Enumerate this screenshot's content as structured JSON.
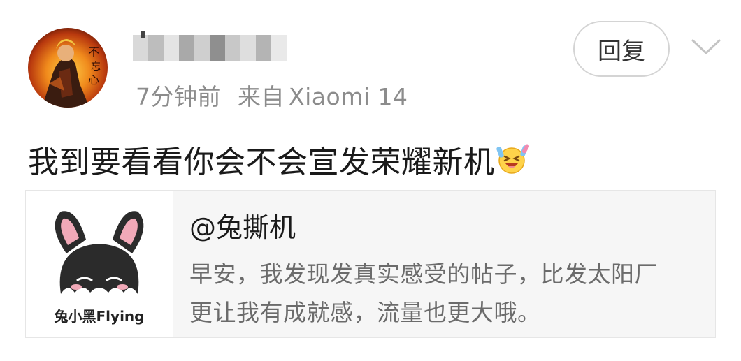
{
  "post": {
    "author_name": "",
    "time": "7分钟前",
    "source_label": "来自",
    "device": "Xiaomi 14",
    "reply_label": "回复",
    "text": "我到要看看你会不会宣发荣耀新机",
    "emoji": "laughing-tears-emoji"
  },
  "quote": {
    "author": "@兔撕机",
    "body_line1": "早安，我发现发真实感受的帖子，比发太阳厂",
    "body_line2": "更让我有成就感，流量也更大哦。",
    "thumb_caption": "兔小黑Flying"
  },
  "colors": {
    "meta_text": "#8c8c8c",
    "body_text": "#1a1a1a",
    "quote_bg": "#f6f6f6",
    "bunny_body": "#2b2b2b",
    "bunny_ear_inner": "#f1a9b8"
  }
}
